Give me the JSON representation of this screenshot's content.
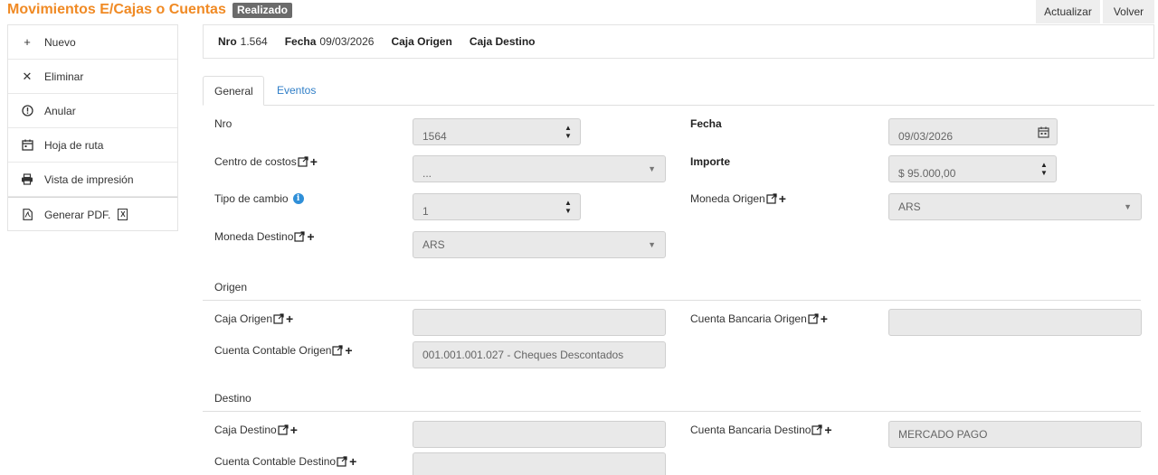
{
  "app": {
    "title": "Movimientos E/Cajas o Cuentas",
    "status_badge": "Realizado",
    "actualizar_label": "Actualizar",
    "volver_label": "Volver"
  },
  "sidebar": {
    "items": [
      {
        "label": "Nuevo",
        "icon": "plus-icon"
      },
      {
        "label": "Eliminar",
        "icon": "x-icon"
      },
      {
        "label": "Anular",
        "icon": "alert-circle-icon"
      },
      {
        "label": "Hoja de ruta",
        "icon": "calendar-icon"
      },
      {
        "label": "Vista de impresión",
        "icon": "printer-icon"
      },
      {
        "label": "Generar PDF.",
        "icon": "pdf-file-icon",
        "extra_icon": "excel-file-icon"
      }
    ]
  },
  "header": {
    "nro_key": "Nro",
    "nro_value": "1.564",
    "fecha_key": "Fecha",
    "fecha_value": "09/03/2026",
    "caja_origen_key": "Caja Origen",
    "caja_destino_key": "Caja Destino"
  },
  "tabs": [
    {
      "label": "General",
      "active": true
    },
    {
      "label": "Eventos",
      "active": false
    }
  ],
  "form": {
    "nro": {
      "label": "Nro",
      "value": "1564"
    },
    "fecha": {
      "label": "Fecha",
      "value": "09/03/2026"
    },
    "centro_costos": {
      "label": "Centro de costos",
      "value": "..."
    },
    "importe": {
      "label": "Importe",
      "value": "$ 95.000,00"
    },
    "tipo_cambio": {
      "label": "Tipo de cambio",
      "value": "1"
    },
    "moneda_origen": {
      "label": "Moneda Origen",
      "value": "ARS"
    },
    "moneda_destino": {
      "label": "Moneda Destino",
      "value": "ARS"
    },
    "origen_section": "Origen",
    "caja_origen": {
      "label": "Caja Origen",
      "value": ""
    },
    "cuenta_bancaria_origen": {
      "label": "Cuenta Bancaria Origen",
      "value": ""
    },
    "cuenta_contable_origen": {
      "label": "Cuenta Contable Origen",
      "value": "001.001.001.027 - Cheques Descontados"
    },
    "destino_section": "Destino",
    "caja_destino": {
      "label": "Caja Destino",
      "value": ""
    },
    "cuenta_bancaria_destino": {
      "label": "Cuenta Bancaria Destino",
      "value": "MERCADO PAGO"
    },
    "cuenta_contable_destino": {
      "label": "Cuenta Contable Destino",
      "value": ""
    }
  },
  "colors": {
    "title_orange": "#f08a24",
    "link_blue": "#2f7ec7",
    "badge_gray": "#6b6b6b",
    "field_bg": "#e9e9e9"
  }
}
